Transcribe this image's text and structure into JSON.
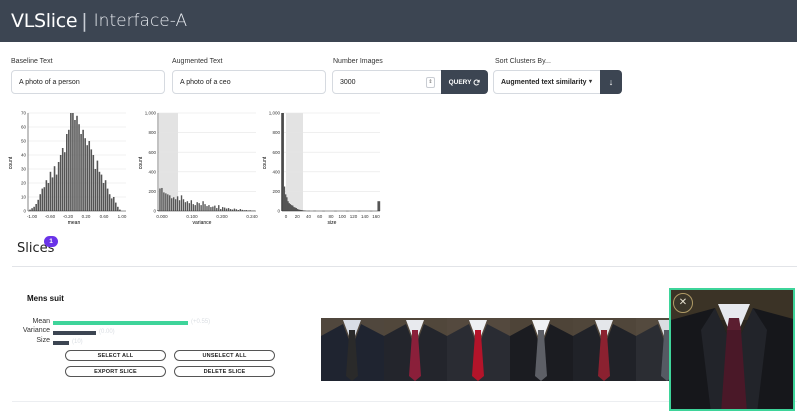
{
  "header": {
    "brand": "VLSlice",
    "separator": "|",
    "subtitle": "Interface-A"
  },
  "form": {
    "baseline": {
      "label": "Baseline Text",
      "value": "A photo of a person"
    },
    "augmented": {
      "label": "Augmented Text",
      "value": "A photo of a ceo"
    },
    "number_images": {
      "label": "Number Images",
      "value": "3000",
      "spinner": "⇕"
    },
    "query_button": {
      "label": "QUERY",
      "icon": "refresh-icon"
    },
    "sort": {
      "label": "Sort Clusters By...",
      "value": "Augmented text similarity",
      "caret": "▾",
      "direction_icon": "arrow-down-icon",
      "direction_glyph": "↓"
    }
  },
  "charts": {
    "mean": {
      "ylabel": "count",
      "xlabel": "mean",
      "yticks": [
        "70",
        "60",
        "50",
        "40",
        "30",
        "20",
        "10",
        "0"
      ],
      "xticks": [
        "-1.00",
        "-0.60",
        "-0.20",
        "0.20",
        "0.60",
        "1.00"
      ]
    },
    "variance": {
      "ylabel": "count",
      "xlabel": "variance",
      "yticks": [
        "1,000",
        "800",
        "600",
        "400",
        "200",
        "0"
      ],
      "xticks": [
        "0.000",
        "0.100",
        "0.200",
        "0.240"
      ]
    },
    "size": {
      "ylabel": "count",
      "xlabel": "size",
      "yticks": [
        "1,000",
        "800",
        "600",
        "400",
        "200",
        "0"
      ],
      "xticks": [
        "0",
        "20",
        "40",
        "60",
        "80",
        "100",
        "120",
        "140",
        "160"
      ]
    }
  },
  "chart_data": [
    {
      "type": "bar",
      "title": "",
      "xlabel": "mean",
      "ylabel": "count",
      "ylim": [
        0,
        70
      ],
      "xlim": [
        -1.2,
        1.2
      ],
      "x": [
        -1.15,
        -1.1,
        -1.05,
        -1.0,
        -0.95,
        -0.9,
        -0.85,
        -0.8,
        -0.75,
        -0.7,
        -0.65,
        -0.6,
        -0.55,
        -0.5,
        -0.45,
        -0.4,
        -0.35,
        -0.3,
        -0.25,
        -0.2,
        -0.15,
        -0.1,
        -0.05,
        0.0,
        0.05,
        0.1,
        0.15,
        0.2,
        0.25,
        0.3,
        0.35,
        0.4,
        0.45,
        0.5,
        0.55,
        0.6,
        0.65,
        0.7,
        0.75,
        0.8,
        0.85,
        0.9,
        0.95,
        1.0,
        1.05
      ],
      "values": [
        1,
        2,
        3,
        5,
        8,
        12,
        16,
        17,
        22,
        20,
        28,
        24,
        32,
        26,
        35,
        40,
        45,
        42,
        55,
        58,
        70,
        70,
        65,
        68,
        62,
        55,
        58,
        52,
        47,
        50,
        44,
        40,
        30,
        36,
        28,
        26,
        20,
        22,
        16,
        12,
        9,
        10,
        6,
        3,
        1
      ]
    },
    {
      "type": "bar",
      "title": "",
      "xlabel": "variance",
      "ylabel": "count",
      "ylim": [
        0,
        1000
      ],
      "xlim": [
        0,
        0.25
      ],
      "x": [
        0.0,
        0.005,
        0.01,
        0.015,
        0.02,
        0.025,
        0.03,
        0.035,
        0.04,
        0.045,
        0.05,
        0.055,
        0.06,
        0.065,
        0.07,
        0.075,
        0.08,
        0.085,
        0.09,
        0.095,
        0.1,
        0.105,
        0.11,
        0.115,
        0.12,
        0.125,
        0.13,
        0.135,
        0.14,
        0.145,
        0.15,
        0.155,
        0.16,
        0.165,
        0.17,
        0.175,
        0.18,
        0.185,
        0.19,
        0.195,
        0.2,
        0.205,
        0.21,
        0.215,
        0.22,
        0.225,
        0.23,
        0.235,
        0.24,
        0.245
      ],
      "values": [
        10,
        230,
        235,
        190,
        180,
        170,
        160,
        130,
        140,
        120,
        150,
        110,
        160,
        120,
        90,
        100,
        80,
        110,
        70,
        60,
        90,
        80,
        60,
        100,
        70,
        50,
        60,
        40,
        45,
        55,
        30,
        60,
        20,
        40,
        35,
        25,
        30,
        20,
        15,
        25,
        18,
        10,
        20,
        12,
        8,
        10,
        6,
        8,
        4,
        5
      ]
    },
    {
      "type": "bar",
      "title": "",
      "xlabel": "size",
      "ylabel": "count",
      "ylim": [
        0,
        1000
      ],
      "xlim": [
        0,
        165
      ],
      "x": [
        1,
        3,
        5,
        7,
        9,
        11,
        13,
        15,
        17,
        19,
        21,
        23,
        25,
        27,
        29,
        31,
        33,
        35,
        37,
        39,
        45,
        55,
        70,
        90,
        110,
        130,
        150,
        163
      ],
      "values": [
        1000,
        250,
        170,
        140,
        100,
        80,
        70,
        60,
        55,
        40,
        35,
        30,
        20,
        15,
        12,
        10,
        8,
        6,
        5,
        3,
        2,
        2,
        1,
        1,
        1,
        1,
        1,
        100
      ]
    }
  ],
  "slices": {
    "title": "Slices",
    "badge": "1"
  },
  "cluster": {
    "title": "Mens suit",
    "stats": [
      {
        "label": "Mean",
        "value": "(+0.55)",
        "fraction": 1.0,
        "color": "#3ed49a"
      },
      {
        "label": "Variance",
        "value": "(0.00)",
        "fraction": 0.32,
        "color": "#3c4552"
      },
      {
        "label": "Size",
        "value": "(10)",
        "fraction": 0.12,
        "color": "#3c4552"
      }
    ],
    "buttons": {
      "select_all": "SELECT ALL",
      "unselect_all": "UNSELECT ALL",
      "export": "EXPORT SLICE",
      "delete": "DELETE SLICE"
    },
    "thumbnails": [
      {
        "suit": "#1f2430",
        "shirt": "#d8dde5",
        "tie": "#2a2a2a"
      },
      {
        "suit": "#23252c",
        "shirt": "#e8eaee",
        "tie": "#8a1f3a"
      },
      {
        "suit": "#2a2c33",
        "shirt": "#eef0f3",
        "tie": "#b3142a"
      },
      {
        "suit": "#1b1c21",
        "shirt": "#f1f2f4",
        "tie": "#5d5f66"
      },
      {
        "suit": "#202228",
        "shirt": "#e4e6ea",
        "tie": "#8b2130"
      },
      {
        "suit": "#2b2d33",
        "shirt": "#dadde2",
        "tie": "#555a63"
      }
    ]
  },
  "preview": {
    "close_glyph": "✕"
  },
  "colors": {
    "header": "#3c4552",
    "accent": "#3ed49a",
    "badge": "#6a33e8",
    "bars": "#555555"
  }
}
